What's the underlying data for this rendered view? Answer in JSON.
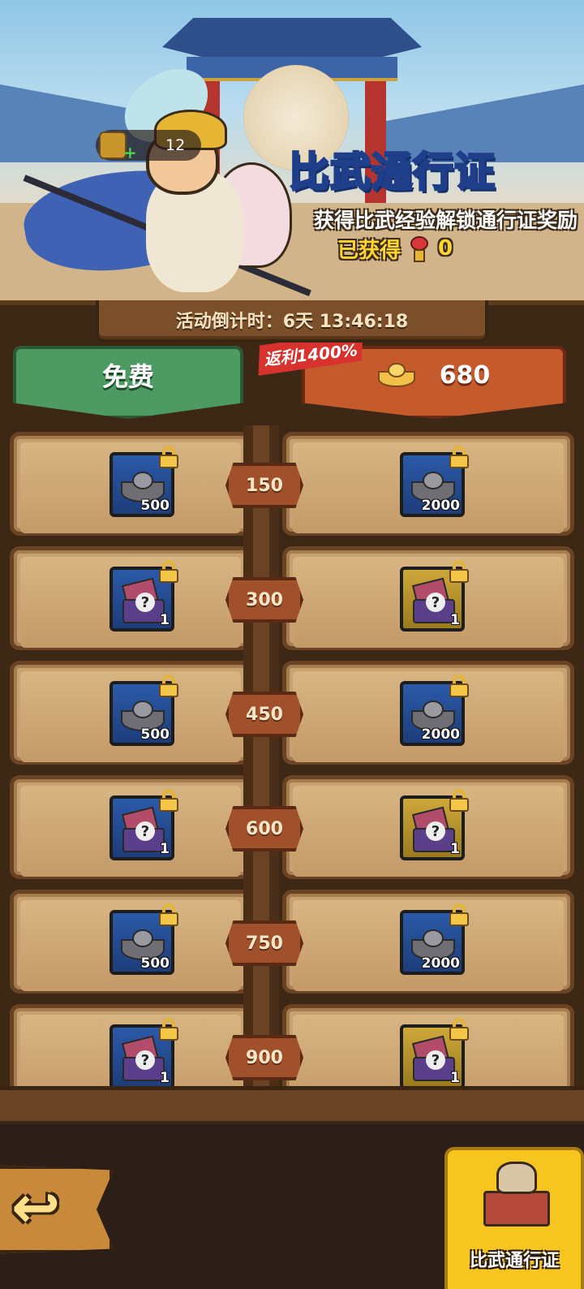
{
  "banner": {
    "title": "比武通行证",
    "subtitle": "获得比武经验解锁通行证奖励",
    "earned_label": "已获得",
    "earned_value": "0",
    "player_level": "12"
  },
  "countdown": "活动倒计时：6天 13:46:18",
  "tracks": {
    "free_label": "免费",
    "paid_price": "680",
    "rebate": "返利1400%"
  },
  "rows": [
    {
      "milestone": "150",
      "free": {
        "type": "silver",
        "frame": "blue",
        "qty": "500"
      },
      "paid": {
        "type": "silver",
        "frame": "blue",
        "qty": "2000"
      }
    },
    {
      "milestone": "300",
      "free": {
        "type": "chest",
        "frame": "blue",
        "qty": "1"
      },
      "paid": {
        "type": "chest",
        "frame": "gold",
        "qty": "1"
      }
    },
    {
      "milestone": "450",
      "free": {
        "type": "silver",
        "frame": "blue",
        "qty": "500"
      },
      "paid": {
        "type": "silver",
        "frame": "blue",
        "qty": "2000"
      }
    },
    {
      "milestone": "600",
      "free": {
        "type": "chest",
        "frame": "blue",
        "qty": "1"
      },
      "paid": {
        "type": "chest",
        "frame": "gold",
        "qty": "1"
      }
    },
    {
      "milestone": "750",
      "free": {
        "type": "silver",
        "frame": "blue",
        "qty": "500"
      },
      "paid": {
        "type": "silver",
        "frame": "blue",
        "qty": "2000"
      }
    },
    {
      "milestone": "900",
      "free": {
        "type": "chest",
        "frame": "blue",
        "qty": "1"
      },
      "paid": {
        "type": "chest",
        "frame": "gold",
        "qty": "1"
      }
    }
  ],
  "footer": {
    "back_icon": "back-arrow-icon",
    "pass_tab_label": "比武通行证"
  }
}
